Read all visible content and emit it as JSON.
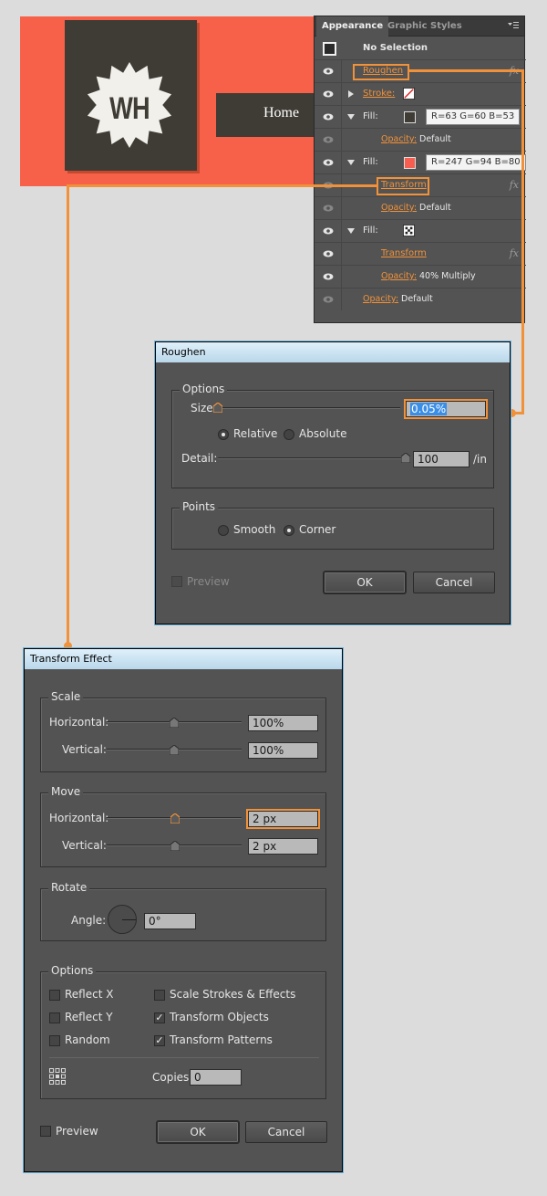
{
  "colors": {
    "artboard": "#f86149",
    "dark": "#3f3c35",
    "accent": "#f1923a",
    "panel": "#535353"
  },
  "artwork": {
    "logo_text": "WH",
    "nav_home": "Home"
  },
  "appearance": {
    "tabs": [
      "Appearance",
      "Graphic Styles"
    ],
    "rows": {
      "no_selection": "No Selection",
      "roughen": "Roughen",
      "stroke": "Stroke:",
      "fill1": "Fill:",
      "fill1_tooltip": "R=63 G=60 B=53",
      "opacity1_label": "Opacity:",
      "opacity1_value": "Default",
      "fill2": "Fill:",
      "fill2_tooltip": "R=247 G=94 B=80",
      "transform1": "Transform",
      "opacity2_label": "Opacity:",
      "opacity2_value": "Default",
      "fill3": "Fill:",
      "transform2": "Transform",
      "opacity3_label": "Opacity:",
      "opacity3_value": "40% Multiply",
      "opacity4_label": "Opacity:",
      "opacity4_value": "Default"
    },
    "fx_label": "fx",
    "fill1_color": "#3f3c35",
    "fill2_color": "#f75e50"
  },
  "roughen": {
    "title": "Roughen",
    "options_label": "Options",
    "size_label": "Size:",
    "size_value": "0.05%",
    "size_level": 0.0005,
    "relative_label": "Relative",
    "absolute_label": "Absolute",
    "relative_selected": true,
    "detail_label": "Detail:",
    "detail_value": "100",
    "detail_unit": "/in",
    "detail_level": 1.0,
    "points_label": "Points",
    "smooth_label": "Smooth",
    "corner_label": "Corner",
    "corner_selected": true,
    "preview_label": "Preview",
    "preview_checked": false,
    "ok_label": "OK",
    "cancel_label": "Cancel"
  },
  "transform": {
    "title": "Transform Effect",
    "scale_label": "Scale",
    "scale_h_label": "Horizontal:",
    "scale_h_value": "100%",
    "scale_v_label": "Vertical:",
    "scale_v_value": "100%",
    "move_label": "Move",
    "move_h_label": "Horizontal:",
    "move_h_value": "2 px",
    "move_v_label": "Vertical:",
    "move_v_value": "2 px",
    "rotate_label": "Rotate",
    "angle_label": "Angle:",
    "angle_value": "0°",
    "options_label": "Options",
    "reflect_x_label": "Reflect X",
    "reflect_y_label": "Reflect Y",
    "random_label": "Random",
    "scale_strokes_label": "Scale Strokes & Effects",
    "transform_objects_label": "Transform Objects",
    "transform_patterns_label": "Transform Patterns",
    "reflect_x_checked": false,
    "reflect_y_checked": false,
    "random_checked": false,
    "scale_strokes_checked": false,
    "transform_objects_checked": true,
    "transform_patterns_checked": true,
    "copies_label": "Copies",
    "copies_value": "0",
    "preview_label": "Preview",
    "preview_checked": false,
    "ok_label": "OK",
    "cancel_label": "Cancel"
  }
}
